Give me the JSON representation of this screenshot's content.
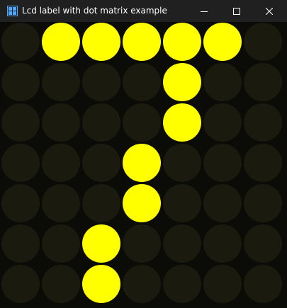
{
  "window": {
    "title": "Lcd label with dot matrix example",
    "controls": {
      "minimize": "minimize-icon",
      "maximize": "maximize-icon",
      "close": "close-icon"
    }
  },
  "lcd": {
    "character": "7",
    "columns": 7,
    "rows": 7,
    "on_color": "#ffff00",
    "off_color": "#1a1a0f",
    "background_color": "#0b0b07",
    "matrix": [
      "0111110",
      "0000100",
      "0000100",
      "0001000",
      "0001000",
      "0010000",
      "0010000"
    ]
  }
}
